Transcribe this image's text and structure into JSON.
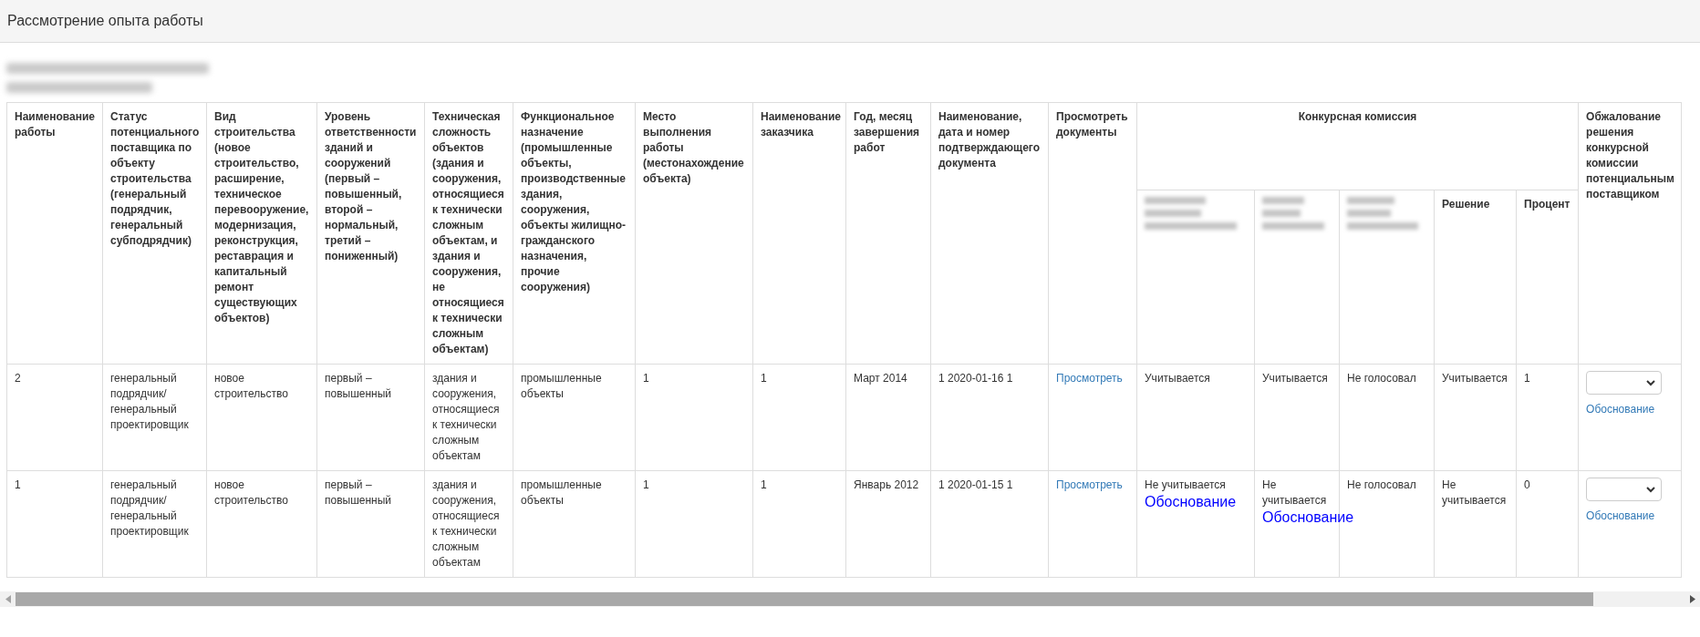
{
  "title": "Рассмотрение опыта работы",
  "redacted_lines": [
    {
      "kind": "redacted"
    },
    {
      "kind": "redacted"
    }
  ],
  "table": {
    "columns": [
      {
        "label": "Наименование работы"
      },
      {
        "label": "Статус потенциального поставщика по объекту строительства (генеральный подрядчик, генеральный субподрядчик)"
      },
      {
        "label": "Вид строительства (новое строительство, расширение, техническое перевооружение, модернизация, реконструкция, реставрация и капитальный ремонт существующих объектов)"
      },
      {
        "label": "Уровень ответственности зданий и сооружений (первый – повышенный, второй – нормальный, третий – пониженный)"
      },
      {
        "label": "Техническая сложность объектов (здания и сооружения, относящиеся к технически сложным объектам, и здания и сооружения, не относящиеся к технически сложным объектам)"
      },
      {
        "label": "Функциональное назначение (промышленные объекты, производственные здания, сооружения, объекты жилищно-гражданского назначения, прочие сооружения)"
      },
      {
        "label": "Место выполнения работы (местонахождение объекта)"
      },
      {
        "label": "Наименование заказчика"
      },
      {
        "label": "Год, месяц завершения работ"
      },
      {
        "label": "Наименование, дата и номер подтверждающего документа"
      },
      {
        "label": "Просмотреть документы"
      }
    ],
    "group": {
      "label": "Конкурсная комиссия",
      "subcolumns": [
        {
          "kind": "redacted"
        },
        {
          "kind": "redacted"
        },
        {
          "kind": "redacted"
        },
        {
          "kind": "text",
          "label": "Решение"
        },
        {
          "kind": "text",
          "label": "Процент"
        }
      ]
    },
    "last_column": {
      "label": "Обжалование решения конкурсной комиссии потенциальным поставщиком"
    },
    "rows": [
      {
        "cells": [
          {
            "kind": "text",
            "text": "2"
          },
          {
            "kind": "text",
            "text": "генеральный подрядчик/ генеральный проектировщик"
          },
          {
            "kind": "text",
            "text": "новое строительство"
          },
          {
            "kind": "text",
            "text": "первый – повышенный"
          },
          {
            "kind": "text",
            "text": "здания и сооружения, относящиеся к технически сложным объектам"
          },
          {
            "kind": "text",
            "text": "промышленные объекты"
          },
          {
            "kind": "text",
            "text": "1"
          },
          {
            "kind": "text",
            "text": "1"
          },
          {
            "kind": "text",
            "text": "Март 2014"
          },
          {
            "kind": "text",
            "text": "1 2020-01-16 1"
          },
          {
            "kind": "link",
            "text": "Просмотреть"
          }
        ],
        "votes": [
          {
            "text": "Учитывается"
          },
          {
            "text": "Учитывается"
          },
          {
            "text": "Не голосовал"
          }
        ],
        "decision": "Учитывается",
        "percent": "1",
        "appeal_link": "Обоснование"
      },
      {
        "cells": [
          {
            "kind": "text",
            "text": "1"
          },
          {
            "kind": "text",
            "text": "генеральный подрядчик/ генеральный проектировщик"
          },
          {
            "kind": "text",
            "text": "новое строительство"
          },
          {
            "kind": "text",
            "text": "первый – повышенный"
          },
          {
            "kind": "text",
            "text": "здания и сооружения, относящиеся к технически сложным объектам"
          },
          {
            "kind": "text",
            "text": "промышленные объекты"
          },
          {
            "kind": "text",
            "text": "1"
          },
          {
            "kind": "text",
            "text": "1"
          },
          {
            "kind": "text",
            "text": "Январь 2012"
          },
          {
            "kind": "text",
            "text": "1 2020-01-15 1"
          },
          {
            "kind": "link",
            "text": "Просмотреть"
          }
        ],
        "votes": [
          {
            "text": "Не учитывается",
            "link": "Обоснование"
          },
          {
            "text": "Не учитывается",
            "link": "Обоснование"
          },
          {
            "text": "Не голосовал"
          }
        ],
        "decision": "Не учитывается",
        "percent": "0",
        "appeal_link": "Обоснование"
      }
    ]
  }
}
